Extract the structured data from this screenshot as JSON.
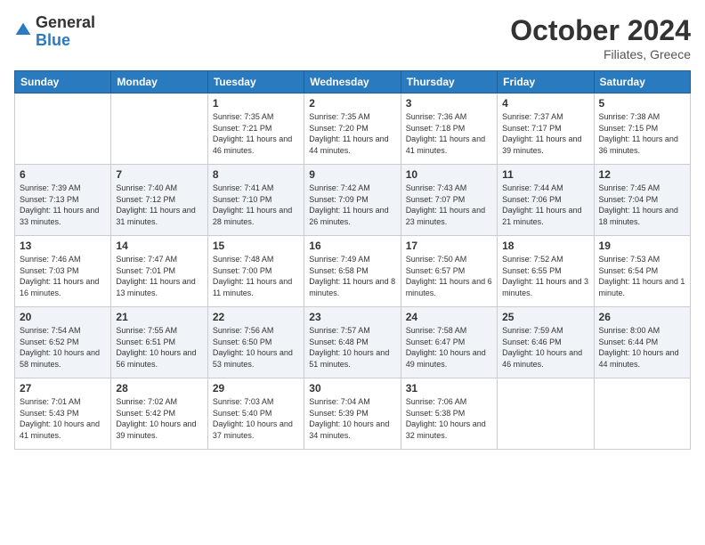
{
  "header": {
    "logo_general": "General",
    "logo_blue": "Blue",
    "month": "October 2024",
    "location": "Filiates, Greece"
  },
  "weekdays": [
    "Sunday",
    "Monday",
    "Tuesday",
    "Wednesday",
    "Thursday",
    "Friday",
    "Saturday"
  ],
  "weeks": [
    [
      {
        "day": "",
        "sunrise": "",
        "sunset": "",
        "daylight": ""
      },
      {
        "day": "",
        "sunrise": "",
        "sunset": "",
        "daylight": ""
      },
      {
        "day": "1",
        "sunrise": "Sunrise: 7:35 AM",
        "sunset": "Sunset: 7:21 PM",
        "daylight": "Daylight: 11 hours and 46 minutes."
      },
      {
        "day": "2",
        "sunrise": "Sunrise: 7:35 AM",
        "sunset": "Sunset: 7:20 PM",
        "daylight": "Daylight: 11 hours and 44 minutes."
      },
      {
        "day": "3",
        "sunrise": "Sunrise: 7:36 AM",
        "sunset": "Sunset: 7:18 PM",
        "daylight": "Daylight: 11 hours and 41 minutes."
      },
      {
        "day": "4",
        "sunrise": "Sunrise: 7:37 AM",
        "sunset": "Sunset: 7:17 PM",
        "daylight": "Daylight: 11 hours and 39 minutes."
      },
      {
        "day": "5",
        "sunrise": "Sunrise: 7:38 AM",
        "sunset": "Sunset: 7:15 PM",
        "daylight": "Daylight: 11 hours and 36 minutes."
      }
    ],
    [
      {
        "day": "6",
        "sunrise": "Sunrise: 7:39 AM",
        "sunset": "Sunset: 7:13 PM",
        "daylight": "Daylight: 11 hours and 33 minutes."
      },
      {
        "day": "7",
        "sunrise": "Sunrise: 7:40 AM",
        "sunset": "Sunset: 7:12 PM",
        "daylight": "Daylight: 11 hours and 31 minutes."
      },
      {
        "day": "8",
        "sunrise": "Sunrise: 7:41 AM",
        "sunset": "Sunset: 7:10 PM",
        "daylight": "Daylight: 11 hours and 28 minutes."
      },
      {
        "day": "9",
        "sunrise": "Sunrise: 7:42 AM",
        "sunset": "Sunset: 7:09 PM",
        "daylight": "Daylight: 11 hours and 26 minutes."
      },
      {
        "day": "10",
        "sunrise": "Sunrise: 7:43 AM",
        "sunset": "Sunset: 7:07 PM",
        "daylight": "Daylight: 11 hours and 23 minutes."
      },
      {
        "day": "11",
        "sunrise": "Sunrise: 7:44 AM",
        "sunset": "Sunset: 7:06 PM",
        "daylight": "Daylight: 11 hours and 21 minutes."
      },
      {
        "day": "12",
        "sunrise": "Sunrise: 7:45 AM",
        "sunset": "Sunset: 7:04 PM",
        "daylight": "Daylight: 11 hours and 18 minutes."
      }
    ],
    [
      {
        "day": "13",
        "sunrise": "Sunrise: 7:46 AM",
        "sunset": "Sunset: 7:03 PM",
        "daylight": "Daylight: 11 hours and 16 minutes."
      },
      {
        "day": "14",
        "sunrise": "Sunrise: 7:47 AM",
        "sunset": "Sunset: 7:01 PM",
        "daylight": "Daylight: 11 hours and 13 minutes."
      },
      {
        "day": "15",
        "sunrise": "Sunrise: 7:48 AM",
        "sunset": "Sunset: 7:00 PM",
        "daylight": "Daylight: 11 hours and 11 minutes."
      },
      {
        "day": "16",
        "sunrise": "Sunrise: 7:49 AM",
        "sunset": "Sunset: 6:58 PM",
        "daylight": "Daylight: 11 hours and 8 minutes."
      },
      {
        "day": "17",
        "sunrise": "Sunrise: 7:50 AM",
        "sunset": "Sunset: 6:57 PM",
        "daylight": "Daylight: 11 hours and 6 minutes."
      },
      {
        "day": "18",
        "sunrise": "Sunrise: 7:52 AM",
        "sunset": "Sunset: 6:55 PM",
        "daylight": "Daylight: 11 hours and 3 minutes."
      },
      {
        "day": "19",
        "sunrise": "Sunrise: 7:53 AM",
        "sunset": "Sunset: 6:54 PM",
        "daylight": "Daylight: 11 hours and 1 minute."
      }
    ],
    [
      {
        "day": "20",
        "sunrise": "Sunrise: 7:54 AM",
        "sunset": "Sunset: 6:52 PM",
        "daylight": "Daylight: 10 hours and 58 minutes."
      },
      {
        "day": "21",
        "sunrise": "Sunrise: 7:55 AM",
        "sunset": "Sunset: 6:51 PM",
        "daylight": "Daylight: 10 hours and 56 minutes."
      },
      {
        "day": "22",
        "sunrise": "Sunrise: 7:56 AM",
        "sunset": "Sunset: 6:50 PM",
        "daylight": "Daylight: 10 hours and 53 minutes."
      },
      {
        "day": "23",
        "sunrise": "Sunrise: 7:57 AM",
        "sunset": "Sunset: 6:48 PM",
        "daylight": "Daylight: 10 hours and 51 minutes."
      },
      {
        "day": "24",
        "sunrise": "Sunrise: 7:58 AM",
        "sunset": "Sunset: 6:47 PM",
        "daylight": "Daylight: 10 hours and 49 minutes."
      },
      {
        "day": "25",
        "sunrise": "Sunrise: 7:59 AM",
        "sunset": "Sunset: 6:46 PM",
        "daylight": "Daylight: 10 hours and 46 minutes."
      },
      {
        "day": "26",
        "sunrise": "Sunrise: 8:00 AM",
        "sunset": "Sunset: 6:44 PM",
        "daylight": "Daylight: 10 hours and 44 minutes."
      }
    ],
    [
      {
        "day": "27",
        "sunrise": "Sunrise: 7:01 AM",
        "sunset": "Sunset: 5:43 PM",
        "daylight": "Daylight: 10 hours and 41 minutes."
      },
      {
        "day": "28",
        "sunrise": "Sunrise: 7:02 AM",
        "sunset": "Sunset: 5:42 PM",
        "daylight": "Daylight: 10 hours and 39 minutes."
      },
      {
        "day": "29",
        "sunrise": "Sunrise: 7:03 AM",
        "sunset": "Sunset: 5:40 PM",
        "daylight": "Daylight: 10 hours and 37 minutes."
      },
      {
        "day": "30",
        "sunrise": "Sunrise: 7:04 AM",
        "sunset": "Sunset: 5:39 PM",
        "daylight": "Daylight: 10 hours and 34 minutes."
      },
      {
        "day": "31",
        "sunrise": "Sunrise: 7:06 AM",
        "sunset": "Sunset: 5:38 PM",
        "daylight": "Daylight: 10 hours and 32 minutes."
      },
      {
        "day": "",
        "sunrise": "",
        "sunset": "",
        "daylight": ""
      },
      {
        "day": "",
        "sunrise": "",
        "sunset": "",
        "daylight": ""
      }
    ]
  ]
}
